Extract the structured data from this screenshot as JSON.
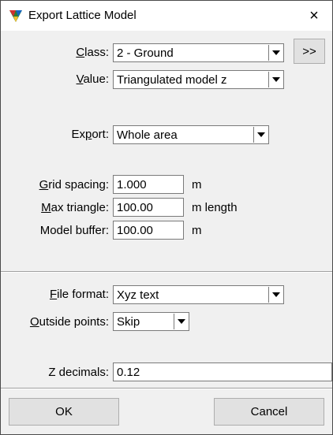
{
  "window": {
    "title": "Export Lattice Model",
    "close_icon": "×"
  },
  "class_field": {
    "label_u": "C",
    "label_rest": "lass:",
    "value": "2 - Ground",
    "more_button": ">>"
  },
  "value_field": {
    "label_u": "V",
    "label_rest": "alue:",
    "value": "Triangulated model z"
  },
  "export_field": {
    "label_pre": "Ex",
    "label_u": "p",
    "label_rest": "ort:",
    "value": "Whole area"
  },
  "grid_spacing": {
    "label_u": "G",
    "label_rest": "rid spacing:",
    "value": "1.000",
    "unit": "m"
  },
  "max_triangle": {
    "label_u": "M",
    "label_rest": "ax triangle:",
    "value": "100.00",
    "unit": "m length"
  },
  "model_buffer": {
    "label": "Model buffer:",
    "value": "100.00",
    "unit": "m"
  },
  "file_format": {
    "label_u": "F",
    "label_rest": "ile format:",
    "value": "Xyz text"
  },
  "outside_points": {
    "label_u": "O",
    "label_rest": "utside points:",
    "value": "Skip"
  },
  "z_decimals": {
    "label": "Z decimals:",
    "value": "0.12"
  },
  "buttons": {
    "ok": "OK",
    "cancel": "Cancel"
  }
}
